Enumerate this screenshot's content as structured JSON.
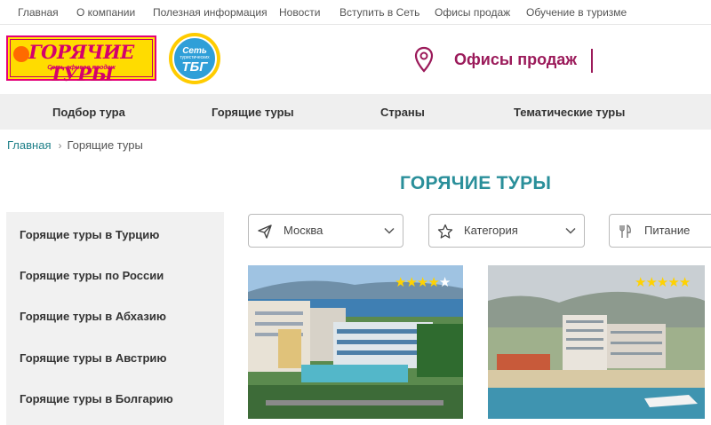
{
  "top_links": [
    "Главная",
    "О компании",
    "Полезная информация",
    "Новости",
    "Вступить в Сеть",
    "Офисы продаж",
    "Обучение в туризме"
  ],
  "logo_hot": {
    "brand": "ГОРЯЧИЕ ТУРЫ",
    "tagline": "Сеть офисов продаж"
  },
  "logo_tbg": {
    "line1": "Сеть",
    "line2": "туристических",
    "line3": "ТБГ"
  },
  "header": {
    "offices_label": "Офисы продаж"
  },
  "main_nav": [
    "Подбор тура",
    "Горящие туры",
    "Страны",
    "Тематические туры"
  ],
  "breadcrumb": {
    "home": "Главная",
    "current": "Горящие туры"
  },
  "page_title": "ГОРЯЧИЕ ТУРЫ",
  "sidebar_items": [
    "Горящие туры в Турцию",
    "Горящие туры по России",
    "Горящие туры в Абхазию",
    "Горящие туры в Австрию",
    "Горящие туры в Болгарию"
  ],
  "filters": [
    {
      "value": "Москва",
      "icon": "paper-plane-icon"
    },
    {
      "value": "Категория",
      "icon": "star-outline-icon"
    },
    {
      "value": "Питание",
      "icon": "food-icon"
    }
  ],
  "cards": [
    {
      "stars": 4,
      "max_stars": 5
    },
    {
      "stars": 5,
      "max_stars": 5
    }
  ],
  "colors": {
    "accent": "#9b1a5a",
    "teal": "#2a8f9a",
    "nav_bg": "#efefef",
    "star": "#ffd200"
  }
}
